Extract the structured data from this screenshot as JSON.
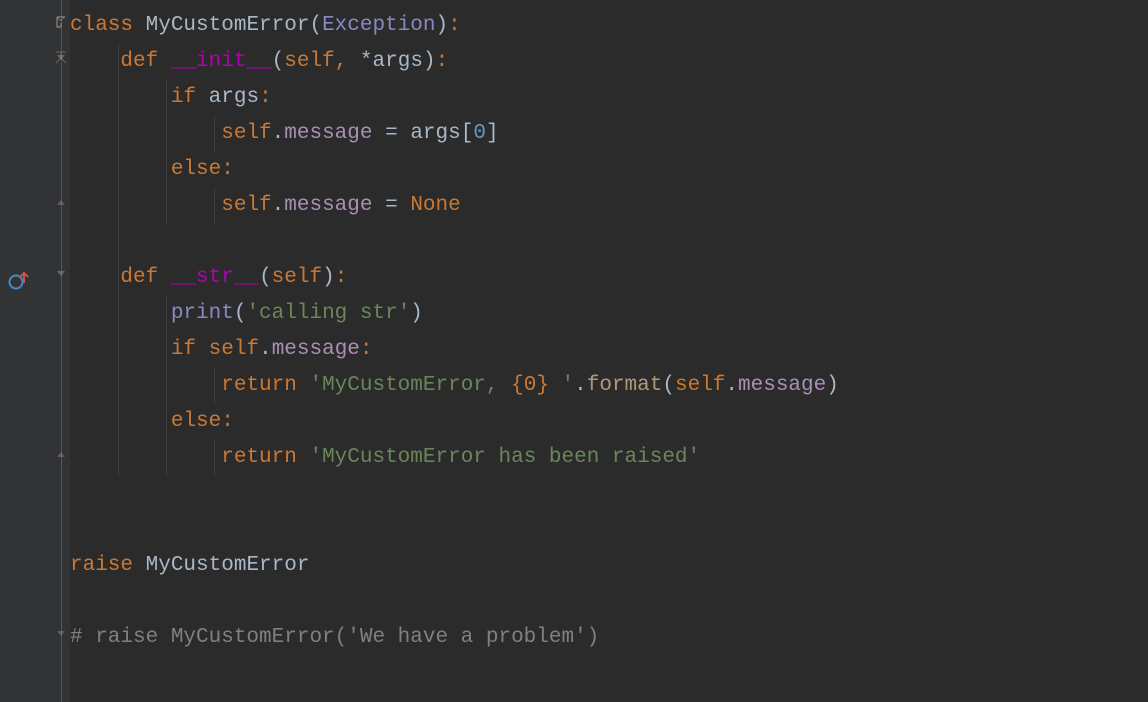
{
  "code": {
    "l1": {
      "kw_class": "class",
      "sp1": " ",
      "name": "MyCustomError",
      "po": "(",
      "base": "Exception",
      "pc": ")",
      "colon": ":"
    },
    "l2": {
      "indent": "    ",
      "kw_def": "def",
      "sp1": " ",
      "name": "__init__",
      "po": "(",
      "self": "self",
      "comma": ",",
      "sp2": " ",
      "star": "*",
      "args": "args",
      "pc": ")",
      "colon": ":"
    },
    "l3": {
      "indent": "        ",
      "kw_if": "if",
      "sp": " ",
      "args": "args",
      "colon": ":"
    },
    "l4": {
      "indent": "            ",
      "self": "self",
      "dot": ".",
      "attr": "message",
      "sp1": " ",
      "eq": "=",
      "sp2": " ",
      "args": "args",
      "bo": "[",
      "idx": "0",
      "bc": "]"
    },
    "l5": {
      "indent": "        ",
      "kw_else": "else",
      "colon": ":"
    },
    "l6": {
      "indent": "            ",
      "self": "self",
      "dot": ".",
      "attr": "message",
      "sp1": " ",
      "eq": "=",
      "sp2": " ",
      "none": "None"
    },
    "l8": {
      "indent": "    ",
      "kw_def": "def",
      "sp1": " ",
      "name": "__str__",
      "po": "(",
      "self": "self",
      "pc": ")",
      "colon": ":"
    },
    "l9": {
      "indent": "        ",
      "fn": "print",
      "po": "(",
      "str": "'calling str'",
      "pc": ")"
    },
    "l10": {
      "indent": "        ",
      "kw_if": "if",
      "sp": " ",
      "self": "self",
      "dot": ".",
      "attr": "message",
      "colon": ":"
    },
    "l11": {
      "indent": "            ",
      "kw_return": "return",
      "sp": " ",
      "str1": "'MyCustomError, ",
      "fmt": "{0}",
      "str2": " '",
      "dot": ".",
      "method": "format",
      "po": "(",
      "self": "self",
      "dot2": ".",
      "attr": "message",
      "pc": ")"
    },
    "l12": {
      "indent": "        ",
      "kw_else": "else",
      "colon": ":"
    },
    "l13": {
      "indent": "            ",
      "kw_return": "return",
      "sp": " ",
      "str": "'MyCustomError has been raised'"
    },
    "l16": {
      "kw_raise": "raise",
      "sp": " ",
      "name": "MyCustomError"
    },
    "l18": {
      "comment": "# raise MyCustomError('We have a problem')"
    }
  },
  "gutter": {
    "override_tooltip": "Overrides method in object"
  }
}
